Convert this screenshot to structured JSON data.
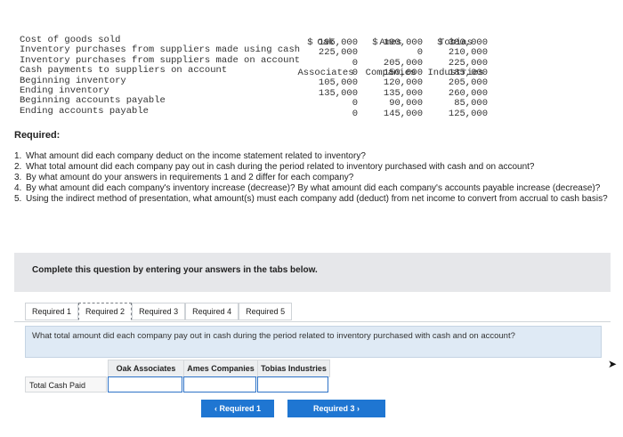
{
  "table": {
    "row_labels": [
      "Cost of goods sold",
      "Inventory purchases from suppliers made using cash",
      "Inventory purchases from suppliers made on account",
      "Cash payments to suppliers on account",
      "Beginning inventory",
      "Ending inventory",
      "Beginning accounts payable",
      "Ending accounts payable"
    ],
    "columns": [
      {
        "header1": "Oak",
        "header2": "Associates",
        "values": [
          "$ 195,000",
          "225,000",
          "0",
          "0",
          "105,000",
          "135,000",
          "0",
          "0"
        ]
      },
      {
        "header1": "Ames",
        "header2": "Companies",
        "values": [
          "$ 190,000",
          "0",
          "205,000",
          "150,000",
          "120,000",
          "135,000",
          "90,000",
          "145,000"
        ]
      },
      {
        "header1": "Tobias",
        "header2": "Industries",
        "values": [
          "$ 380,000",
          "210,000",
          "225,000",
          "185,000",
          "205,000",
          "260,000",
          "85,000",
          "125,000"
        ]
      }
    ]
  },
  "required_heading": "Required:",
  "questions": [
    {
      "num": "1.",
      "text": "What amount did each company deduct on the income statement related to inventory?"
    },
    {
      "num": "2.",
      "text": "What total amount did each company pay out in cash during the period related to inventory purchased with cash and on account?"
    },
    {
      "num": "3.",
      "text": "By what amount do your answers in requirements 1 and 2 differ for each company?"
    },
    {
      "num": "4.",
      "text": "By what amount did each company's inventory increase (decrease)? By what amount did each company's accounts payable increase (decrease)?"
    },
    {
      "num": "5.",
      "text": "Using the indirect method of presentation, what amount(s) must each company add (deduct) from net income to convert from accrual to cash basis?"
    }
  ],
  "panel_text": "Complete this question by entering your answers in the tabs below.",
  "tabs": [
    "Required 1",
    "Required 2",
    "Required 3",
    "Required 4",
    "Required 5"
  ],
  "active_tab": "Required 2",
  "question_box": "What total amount did each company pay out in cash during the period related to inventory purchased with cash and on account?",
  "answer_headers": [
    "Oak Associates",
    "Ames Companies",
    "Tobias Industries"
  ],
  "answer_row_label": "Total Cash Paid",
  "answer_values": [
    "",
    "",
    ""
  ],
  "buttons": {
    "prev": "Required 1",
    "next": "Required 3"
  },
  "icons": {
    "prev": "chevron-left-icon",
    "next": "chevron-right-icon"
  },
  "colors": {
    "button": "#1f76d2",
    "answer_box": "#dfeaf5",
    "input_border": "#2e73c7"
  }
}
